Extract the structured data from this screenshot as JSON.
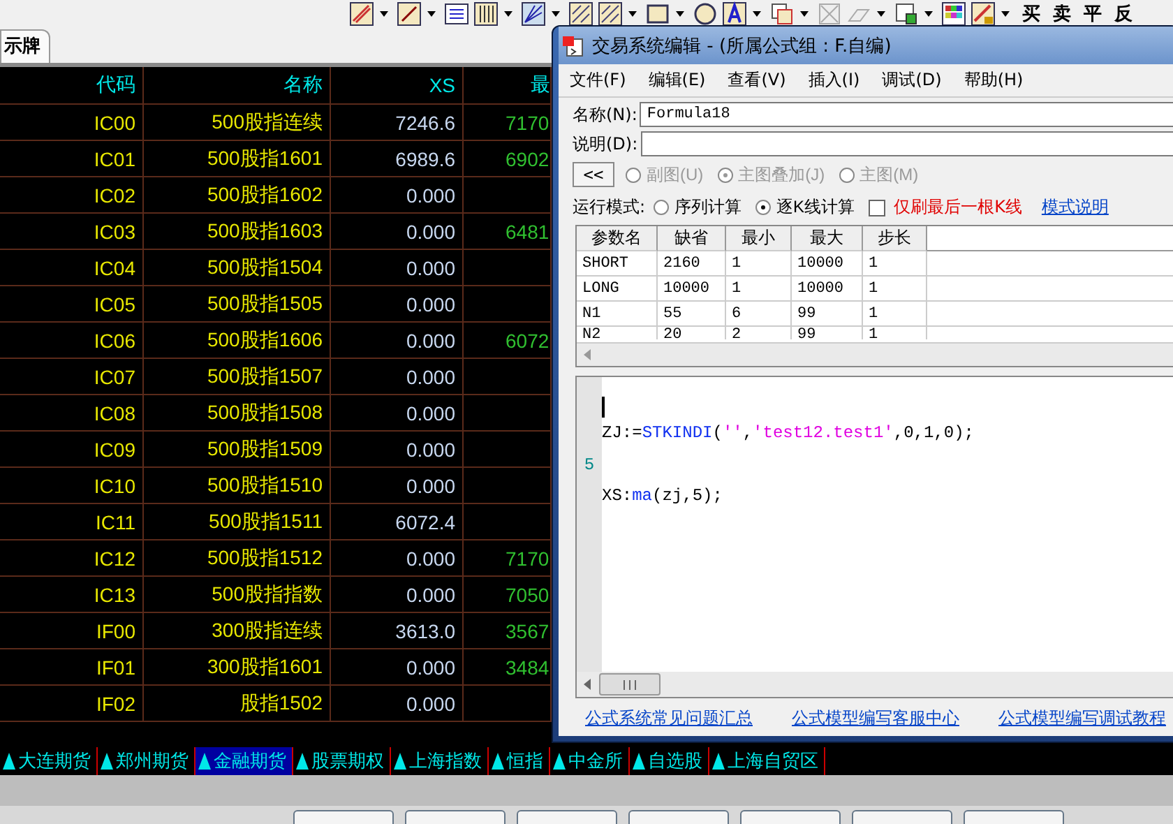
{
  "toolbar": {
    "trade_buttons": [
      "买",
      "卖",
      "平",
      "反"
    ]
  },
  "top_tabs": [
    {
      "label": "示牌"
    }
  ],
  "table": {
    "columns": [
      "代码",
      "名称",
      "XS",
      "最"
    ],
    "rows": [
      {
        "code": "IC00",
        "name": "500股指连续",
        "xs": "7246.6",
        "column_4": "7170"
      },
      {
        "code": "IC01",
        "name": "500股指1601",
        "xs": "6989.6",
        "column_4": "6902"
      },
      {
        "code": "IC02",
        "name": "500股指1602",
        "xs": "0.000"
      },
      {
        "code": "IC03",
        "name": "500股指1603",
        "xs": "0.000",
        "column_4": "6481"
      },
      {
        "code": "IC04",
        "name": "500股指1504",
        "xs": "0.000"
      },
      {
        "code": "IC05",
        "name": "500股指1505",
        "xs": "0.000"
      },
      {
        "code": "IC06",
        "name": "500股指1606",
        "xs": "0.000",
        "column_4": "6072"
      },
      {
        "code": "IC07",
        "name": "500股指1507",
        "xs": "0.000"
      },
      {
        "code": "IC08",
        "name": "500股指1508",
        "xs": "0.000"
      },
      {
        "code": "IC09",
        "name": "500股指1509",
        "xs": "0.000"
      },
      {
        "code": "IC10",
        "name": "500股指1510",
        "xs": "0.000"
      },
      {
        "code": "IC11",
        "name": "500股指1511",
        "xs": "6072.4"
      },
      {
        "code": "IC12",
        "name": "500股指1512",
        "xs": "0.000",
        "column_4": "7170"
      },
      {
        "code": "IC13",
        "name": "500股指指数",
        "xs": "0.000",
        "column_4": "7050"
      },
      {
        "code": "IF00",
        "name": "300股指连续",
        "xs": "3613.0",
        "column_4": "3567"
      },
      {
        "code": "IF01",
        "name": "300股指1601",
        "xs": "0.000",
        "column_4": "3484"
      },
      {
        "code": "IF02",
        "name": "股指1502",
        "xs": "0.000"
      }
    ]
  },
  "market_tabs": [
    {
      "label": "大连期货",
      "selected": false
    },
    {
      "label": "郑州期货",
      "selected": false
    },
    {
      "label": "金融期货",
      "selected": true
    },
    {
      "label": "股票期权",
      "selected": false
    },
    {
      "label": "上海指数",
      "selected": false
    },
    {
      "label": "恒指",
      "selected": false
    },
    {
      "label": "中金所",
      "selected": false
    },
    {
      "label": "自选股",
      "selected": false
    },
    {
      "label": "上海自贸区",
      "selected": false
    }
  ],
  "dialog": {
    "title": "交易系统编辑 - (所属公式组 : F.自编)",
    "menu": [
      "文件(F)",
      "编辑(E)",
      "查看(V)",
      "插入(I)",
      "调试(D)",
      "帮助(H)"
    ],
    "name_label": "名称(N):",
    "name_value": "Formula18",
    "description_label": "说明(D):",
    "collapse_button": "<<",
    "chart_options": [
      {
        "label": "副图(U)",
        "selected": false,
        "disabled": true
      },
      {
        "label": "主图叠加(J)",
        "selected": true,
        "disabled": true
      },
      {
        "label": "主图(M)",
        "selected": false,
        "disabled": true
      }
    ],
    "run_mode_label": "运行模式:",
    "run_modes": [
      {
        "label": "序列计算",
        "selected": false
      },
      {
        "label": "逐K线计算",
        "selected": true
      }
    ],
    "refresh_last_bar": {
      "label": "仅刷最后一根K线",
      "checked": false
    },
    "mode_help_link": "模式说明",
    "params": {
      "columns": [
        "参数名",
        "缺省",
        "最小",
        "最大",
        "步长"
      ],
      "rows": [
        [
          "SHORT",
          "2160",
          "1",
          "10000",
          "1"
        ],
        [
          "LONG",
          "10000",
          "1",
          "10000",
          "1"
        ],
        [
          "N1",
          "55",
          "6",
          "99",
          "1"
        ],
        [
          "N2",
          "20",
          "2",
          "99",
          "1"
        ]
      ]
    },
    "editor": {
      "lines": [
        {
          "cursor": true
        },
        {
          "tokens": [
            {
              "kind": "plain",
              "text": "ZJ:="
            },
            {
              "kind": "function",
              "text": "STKINDI"
            },
            {
              "kind": "plain",
              "text": "("
            },
            {
              "kind": "string",
              "text": "''"
            },
            {
              "kind": "plain",
              "text": ","
            },
            {
              "kind": "string",
              "text": "'test12.test1'"
            },
            {
              "kind": "plain",
              "text": ",0,1,0);"
            }
          ]
        },
        {
          "gutter": "5"
        },
        {
          "tokens": [
            {
              "kind": "plain",
              "text": "XS:"
            },
            {
              "kind": "function",
              "text": "ma"
            },
            {
              "kind": "plain",
              "text": "(zj,5);"
            }
          ]
        }
      ]
    },
    "links": [
      "公式系统常见问题汇总",
      "公式模型编写客服中心",
      "公式模型编写调试教程"
    ]
  }
}
